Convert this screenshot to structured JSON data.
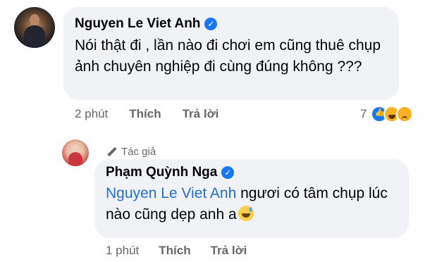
{
  "comment": {
    "author": "Nguyen Le Viet Anh",
    "text": "Nói thật đi , lần nào đi chơi em cũng thuê chụp ảnh chuyên nghiệp đi cùng đúng không ???",
    "time": "2 phút",
    "like_label": "Thích",
    "reply_label": "Trả lời",
    "reaction_count": "7",
    "reactions": [
      "like-icon",
      "haha-icon",
      "sad-icon"
    ]
  },
  "reply": {
    "badge": "Tác giả",
    "author": "Phạm Quỳnh Nga",
    "mention": "Nguyen Le Viet Anh",
    "text": " ngươi có tâm chụp lúc nào cũng dẹp anh a",
    "emoji": "sweat-smile-icon",
    "time": "1 phút",
    "like_label": "Thích",
    "reply_label": "Trả lời"
  },
  "colors": {
    "bubble": "#f0f2f5",
    "mention": "#216fdb",
    "verified": "#1877f2",
    "meta": "#65676b"
  }
}
